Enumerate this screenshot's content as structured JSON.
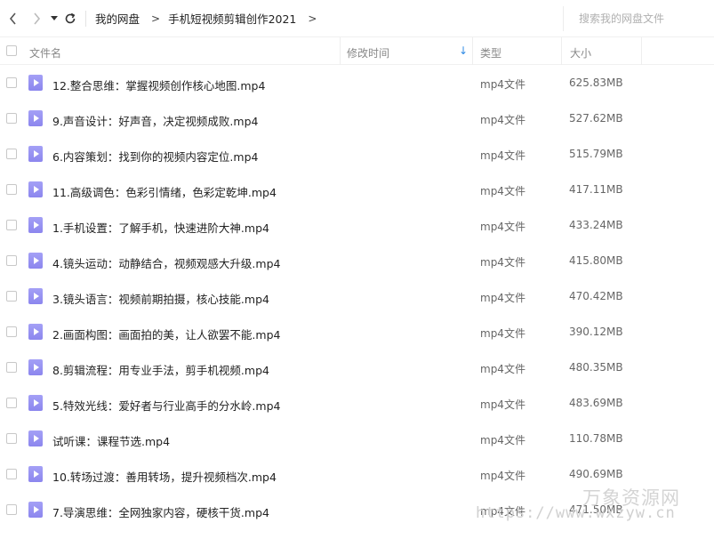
{
  "toolbar": {
    "back_icon": "‹",
    "forward_icon": "›",
    "dropdown_icon": "▼",
    "refresh_icon": "⟳"
  },
  "breadcrumb": {
    "items": [
      "我的网盘",
      "手机短视频剪辑创作2021"
    ],
    "separator": ">"
  },
  "search": {
    "placeholder": "搜索我的网盘文件"
  },
  "columns": {
    "name": "文件名",
    "modified": "修改时间",
    "sort_icon": "↓",
    "type": "类型",
    "size": "大小"
  },
  "files": [
    {
      "name": "12.整合思维：掌握视频创作核心地图.mp4",
      "type": "mp4文件",
      "size": "625.83MB"
    },
    {
      "name": "9.声音设计：好声音，决定视频成败.mp4",
      "type": "mp4文件",
      "size": "527.62MB"
    },
    {
      "name": "6.内容策划：找到你的视频内容定位.mp4",
      "type": "mp4文件",
      "size": "515.79MB"
    },
    {
      "name": "11.高级调色：色彩引情绪，色彩定乾坤.mp4",
      "type": "mp4文件",
      "size": "417.11MB"
    },
    {
      "name": "1.手机设置：了解手机，快速进阶大神.mp4",
      "type": "mp4文件",
      "size": "433.24MB"
    },
    {
      "name": "4.镜头运动：动静结合，视频观感大升级.mp4",
      "type": "mp4文件",
      "size": "415.80MB"
    },
    {
      "name": "3.镜头语言：视频前期拍摄，核心技能.mp4",
      "type": "mp4文件",
      "size": "470.42MB"
    },
    {
      "name": "2.画面构图：画面拍的美，让人欲罢不能.mp4",
      "type": "mp4文件",
      "size": "390.12MB"
    },
    {
      "name": "8.剪辑流程：用专业手法，剪手机视频.mp4",
      "type": "mp4文件",
      "size": "480.35MB"
    },
    {
      "name": "5.特效光线：爱好者与行业高手的分水岭.mp4",
      "type": "mp4文件",
      "size": "483.69MB"
    },
    {
      "name": "试听课：课程节选.mp4",
      "type": "mp4文件",
      "size": "110.78MB"
    },
    {
      "name": "10.转场过渡：善用转场，提升视频档次.mp4",
      "type": "mp4文件",
      "size": "490.69MB"
    },
    {
      "name": "7.导演思维：全网独家内容，硬核干货.mp4",
      "type": "mp4文件",
      "size": "471.50MB"
    }
  ],
  "watermark": {
    "text": "万象资源网",
    "url": "https://www.wxzyw.cn"
  },
  "colors": {
    "icon": "#968ff2",
    "sort_accent": "#2f8ae5"
  }
}
